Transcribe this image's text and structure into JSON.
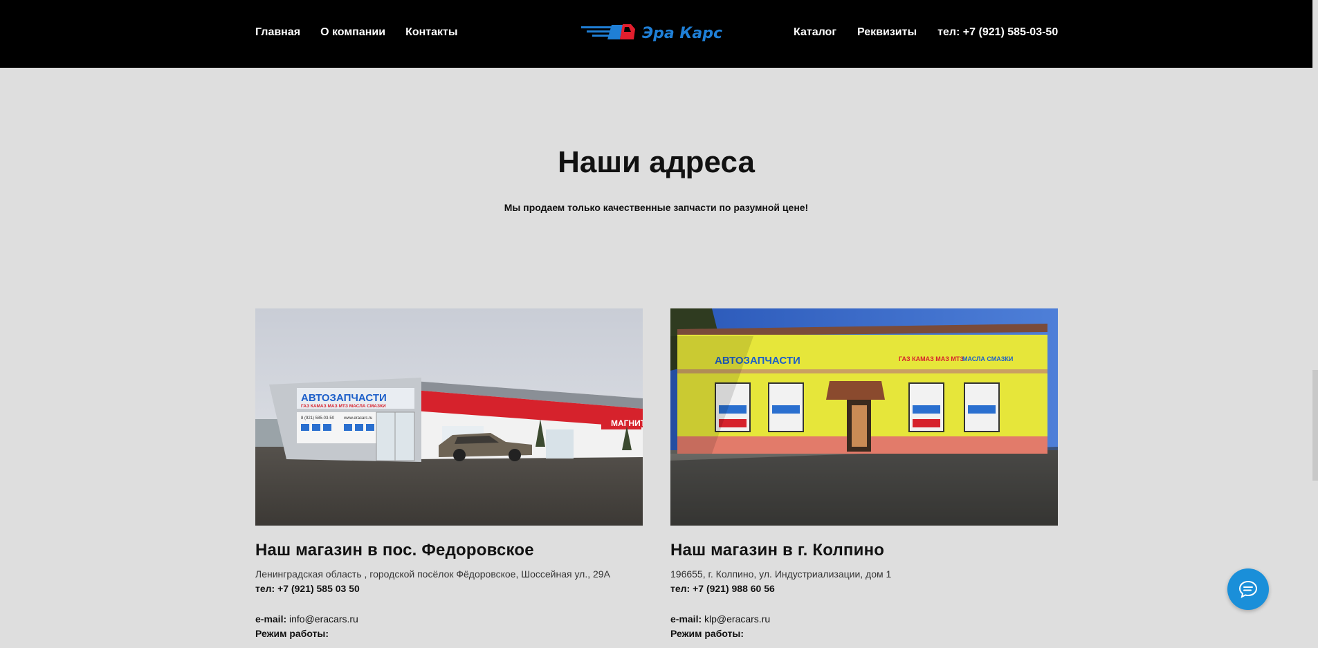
{
  "nav": {
    "left": [
      "Главная",
      "О компании",
      "Контакты"
    ],
    "right": [
      "Каталог",
      "Реквизиты",
      "тел: +7 (921) 585-03-50"
    ],
    "logo_text": "Эра Карс"
  },
  "section": {
    "title": "Наши адреса",
    "subtitle": "Мы продаем только качественные запчасти по разумной цене!"
  },
  "stores": [
    {
      "title": "Наш магазин в пос. Федоровское",
      "address": "Ленинградская область , городской посёлок Фёдоровское, Шоссейная ул., 29А",
      "phone_label": "тел",
      "phone": ": +7 (921) 585 03 50",
      "email_label": "e-mail:",
      "email": "info@eracars.ru",
      "hours_label": "Режим работы:",
      "sign_main": "АВТОЗАПЧАСТИ",
      "sign_brands": "ГАЗ КАМАЗ МАЗ МТЗ МАСЛА СМАЗКИ",
      "sign_phone": "8 (921) 585-03-50",
      "sign_site": "www.eracars.ru",
      "neighbor_sign": "МАГНИТ"
    },
    {
      "title": "Наш магазин в г. Колпино",
      "address": "196655, г. Колпино, ул. Индустриализации, дом 1",
      "phone_label": "тел:",
      "phone": " +7 (921) 988 60 56",
      "email_label": "e-mail:",
      "email": "klp@eracars.ru",
      "hours_label": "Режим работы:",
      "sign_main": "АВТОЗАПЧАСТИ",
      "sign_brands": "ГАЗ КАМАЗ МАЗ МТЗ",
      "sign_brands2": "МАСЛА СМАЗКИ"
    }
  ],
  "colors": {
    "nav_bg": "#000000",
    "page_bg": "#dedede",
    "chat_button": "#1a8fd9",
    "logo_blue": "#1f7fd6",
    "logo_red": "#e31e2d"
  },
  "icons": {
    "chat": "chat-bubble-icon"
  }
}
